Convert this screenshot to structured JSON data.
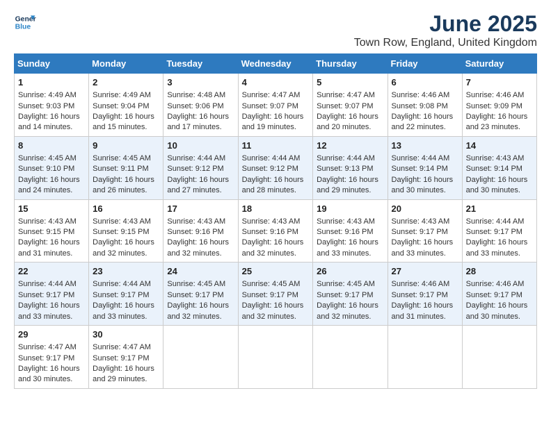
{
  "logo": {
    "line1": "General",
    "line2": "Blue"
  },
  "title": "June 2025",
  "location": "Town Row, England, United Kingdom",
  "days_header": [
    "Sunday",
    "Monday",
    "Tuesday",
    "Wednesday",
    "Thursday",
    "Friday",
    "Saturday"
  ],
  "weeks": [
    [
      {
        "day": 1,
        "lines": [
          "Sunrise: 4:49 AM",
          "Sunset: 9:03 PM",
          "Daylight: 16 hours",
          "and 14 minutes."
        ]
      },
      {
        "day": 2,
        "lines": [
          "Sunrise: 4:49 AM",
          "Sunset: 9:04 PM",
          "Daylight: 16 hours",
          "and 15 minutes."
        ]
      },
      {
        "day": 3,
        "lines": [
          "Sunrise: 4:48 AM",
          "Sunset: 9:06 PM",
          "Daylight: 16 hours",
          "and 17 minutes."
        ]
      },
      {
        "day": 4,
        "lines": [
          "Sunrise: 4:47 AM",
          "Sunset: 9:07 PM",
          "Daylight: 16 hours",
          "and 19 minutes."
        ]
      },
      {
        "day": 5,
        "lines": [
          "Sunrise: 4:47 AM",
          "Sunset: 9:07 PM",
          "Daylight: 16 hours",
          "and 20 minutes."
        ]
      },
      {
        "day": 6,
        "lines": [
          "Sunrise: 4:46 AM",
          "Sunset: 9:08 PM",
          "Daylight: 16 hours",
          "and 22 minutes."
        ]
      },
      {
        "day": 7,
        "lines": [
          "Sunrise: 4:46 AM",
          "Sunset: 9:09 PM",
          "Daylight: 16 hours",
          "and 23 minutes."
        ]
      }
    ],
    [
      {
        "day": 8,
        "lines": [
          "Sunrise: 4:45 AM",
          "Sunset: 9:10 PM",
          "Daylight: 16 hours",
          "and 24 minutes."
        ]
      },
      {
        "day": 9,
        "lines": [
          "Sunrise: 4:45 AM",
          "Sunset: 9:11 PM",
          "Daylight: 16 hours",
          "and 26 minutes."
        ]
      },
      {
        "day": 10,
        "lines": [
          "Sunrise: 4:44 AM",
          "Sunset: 9:12 PM",
          "Daylight: 16 hours",
          "and 27 minutes."
        ]
      },
      {
        "day": 11,
        "lines": [
          "Sunrise: 4:44 AM",
          "Sunset: 9:12 PM",
          "Daylight: 16 hours",
          "and 28 minutes."
        ]
      },
      {
        "day": 12,
        "lines": [
          "Sunrise: 4:44 AM",
          "Sunset: 9:13 PM",
          "Daylight: 16 hours",
          "and 29 minutes."
        ]
      },
      {
        "day": 13,
        "lines": [
          "Sunrise: 4:44 AM",
          "Sunset: 9:14 PM",
          "Daylight: 16 hours",
          "and 30 minutes."
        ]
      },
      {
        "day": 14,
        "lines": [
          "Sunrise: 4:43 AM",
          "Sunset: 9:14 PM",
          "Daylight: 16 hours",
          "and 30 minutes."
        ]
      }
    ],
    [
      {
        "day": 15,
        "lines": [
          "Sunrise: 4:43 AM",
          "Sunset: 9:15 PM",
          "Daylight: 16 hours",
          "and 31 minutes."
        ]
      },
      {
        "day": 16,
        "lines": [
          "Sunrise: 4:43 AM",
          "Sunset: 9:15 PM",
          "Daylight: 16 hours",
          "and 32 minutes."
        ]
      },
      {
        "day": 17,
        "lines": [
          "Sunrise: 4:43 AM",
          "Sunset: 9:16 PM",
          "Daylight: 16 hours",
          "and 32 minutes."
        ]
      },
      {
        "day": 18,
        "lines": [
          "Sunrise: 4:43 AM",
          "Sunset: 9:16 PM",
          "Daylight: 16 hours",
          "and 32 minutes."
        ]
      },
      {
        "day": 19,
        "lines": [
          "Sunrise: 4:43 AM",
          "Sunset: 9:16 PM",
          "Daylight: 16 hours",
          "and 33 minutes."
        ]
      },
      {
        "day": 20,
        "lines": [
          "Sunrise: 4:43 AM",
          "Sunset: 9:17 PM",
          "Daylight: 16 hours",
          "and 33 minutes."
        ]
      },
      {
        "day": 21,
        "lines": [
          "Sunrise: 4:44 AM",
          "Sunset: 9:17 PM",
          "Daylight: 16 hours",
          "and 33 minutes."
        ]
      }
    ],
    [
      {
        "day": 22,
        "lines": [
          "Sunrise: 4:44 AM",
          "Sunset: 9:17 PM",
          "Daylight: 16 hours",
          "and 33 minutes."
        ]
      },
      {
        "day": 23,
        "lines": [
          "Sunrise: 4:44 AM",
          "Sunset: 9:17 PM",
          "Daylight: 16 hours",
          "and 33 minutes."
        ]
      },
      {
        "day": 24,
        "lines": [
          "Sunrise: 4:45 AM",
          "Sunset: 9:17 PM",
          "Daylight: 16 hours",
          "and 32 minutes."
        ]
      },
      {
        "day": 25,
        "lines": [
          "Sunrise: 4:45 AM",
          "Sunset: 9:17 PM",
          "Daylight: 16 hours",
          "and 32 minutes."
        ]
      },
      {
        "day": 26,
        "lines": [
          "Sunrise: 4:45 AM",
          "Sunset: 9:17 PM",
          "Daylight: 16 hours",
          "and 32 minutes."
        ]
      },
      {
        "day": 27,
        "lines": [
          "Sunrise: 4:46 AM",
          "Sunset: 9:17 PM",
          "Daylight: 16 hours",
          "and 31 minutes."
        ]
      },
      {
        "day": 28,
        "lines": [
          "Sunrise: 4:46 AM",
          "Sunset: 9:17 PM",
          "Daylight: 16 hours",
          "and 30 minutes."
        ]
      }
    ],
    [
      {
        "day": 29,
        "lines": [
          "Sunrise: 4:47 AM",
          "Sunset: 9:17 PM",
          "Daylight: 16 hours",
          "and 30 minutes."
        ]
      },
      {
        "day": 30,
        "lines": [
          "Sunrise: 4:47 AM",
          "Sunset: 9:17 PM",
          "Daylight: 16 hours",
          "and 29 minutes."
        ]
      },
      null,
      null,
      null,
      null,
      null
    ]
  ]
}
